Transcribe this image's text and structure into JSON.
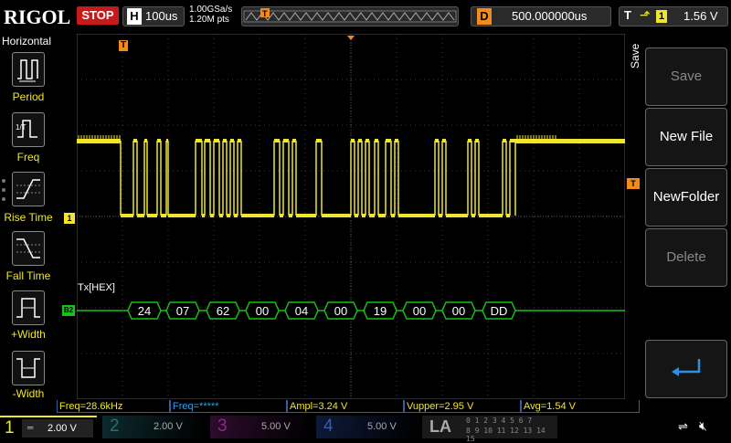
{
  "top": {
    "logo": "RIGOL",
    "run_state": "STOP",
    "h_key": "H",
    "h_value": "100us",
    "sample_rate": "1.00GSa/s",
    "points": "1.20M pts",
    "d_key": "D",
    "d_value": "500.000000us",
    "t_key": "T",
    "t_channel": "1",
    "t_value": "1.56 V"
  },
  "left_menu": {
    "title": "Horizontal",
    "items": [
      {
        "label": "Period",
        "icon": "period-icon"
      },
      {
        "label": "Freq",
        "icon": "freq-icon"
      },
      {
        "label": "Rise Time",
        "icon": "rise-time-icon"
      },
      {
        "label": "Fall Time",
        "icon": "fall-time-icon"
      },
      {
        "label": "+Width",
        "icon": "pos-width-icon"
      },
      {
        "label": "-Width",
        "icon": "neg-width-icon"
      }
    ]
  },
  "right_menu": {
    "title": "Save",
    "items": [
      {
        "label": "Save",
        "enabled": false
      },
      {
        "label": "New File",
        "enabled": true
      },
      {
        "label": "NewFolder",
        "enabled": true
      },
      {
        "label": "Delete",
        "enabled": false
      },
      {
        "label": "",
        "icon": "enter-icon",
        "enabled": true
      }
    ]
  },
  "waveform": {
    "ch1_marker": "1",
    "bus_marker": "B2",
    "bus_label": "Tx[HEX]",
    "bytes": [
      "24",
      "07",
      "62",
      "00",
      "04",
      "00",
      "19",
      "00",
      "00",
      "DD"
    ]
  },
  "measurements": [
    "Freq=28.6kHz",
    "Freq=*****",
    "Ampl=3.24 V",
    "Vupper=2.95 V",
    "Avg=1.54 V"
  ],
  "channels": [
    {
      "num": "1",
      "scale": "2.00 V",
      "color": "#f0e62b",
      "active": true
    },
    {
      "num": "2",
      "scale": "2.00 V",
      "color": "#2fc3d6",
      "active": false
    },
    {
      "num": "3",
      "scale": "5.00 V",
      "color": "#c42bc4",
      "active": false
    },
    {
      "num": "4",
      "scale": "5.00 V",
      "color": "#3b6bd6",
      "active": false
    }
  ],
  "la": {
    "label": "LA",
    "row1": "0 1 2 3  4 5 6 7",
    "row2": "8 9 10 11  12 13 14 15"
  },
  "colors": {
    "ch1": "#f0e62b",
    "bus": "#19c019",
    "grid": "#3a3a3a",
    "trigger": "#f28a1e"
  }
}
